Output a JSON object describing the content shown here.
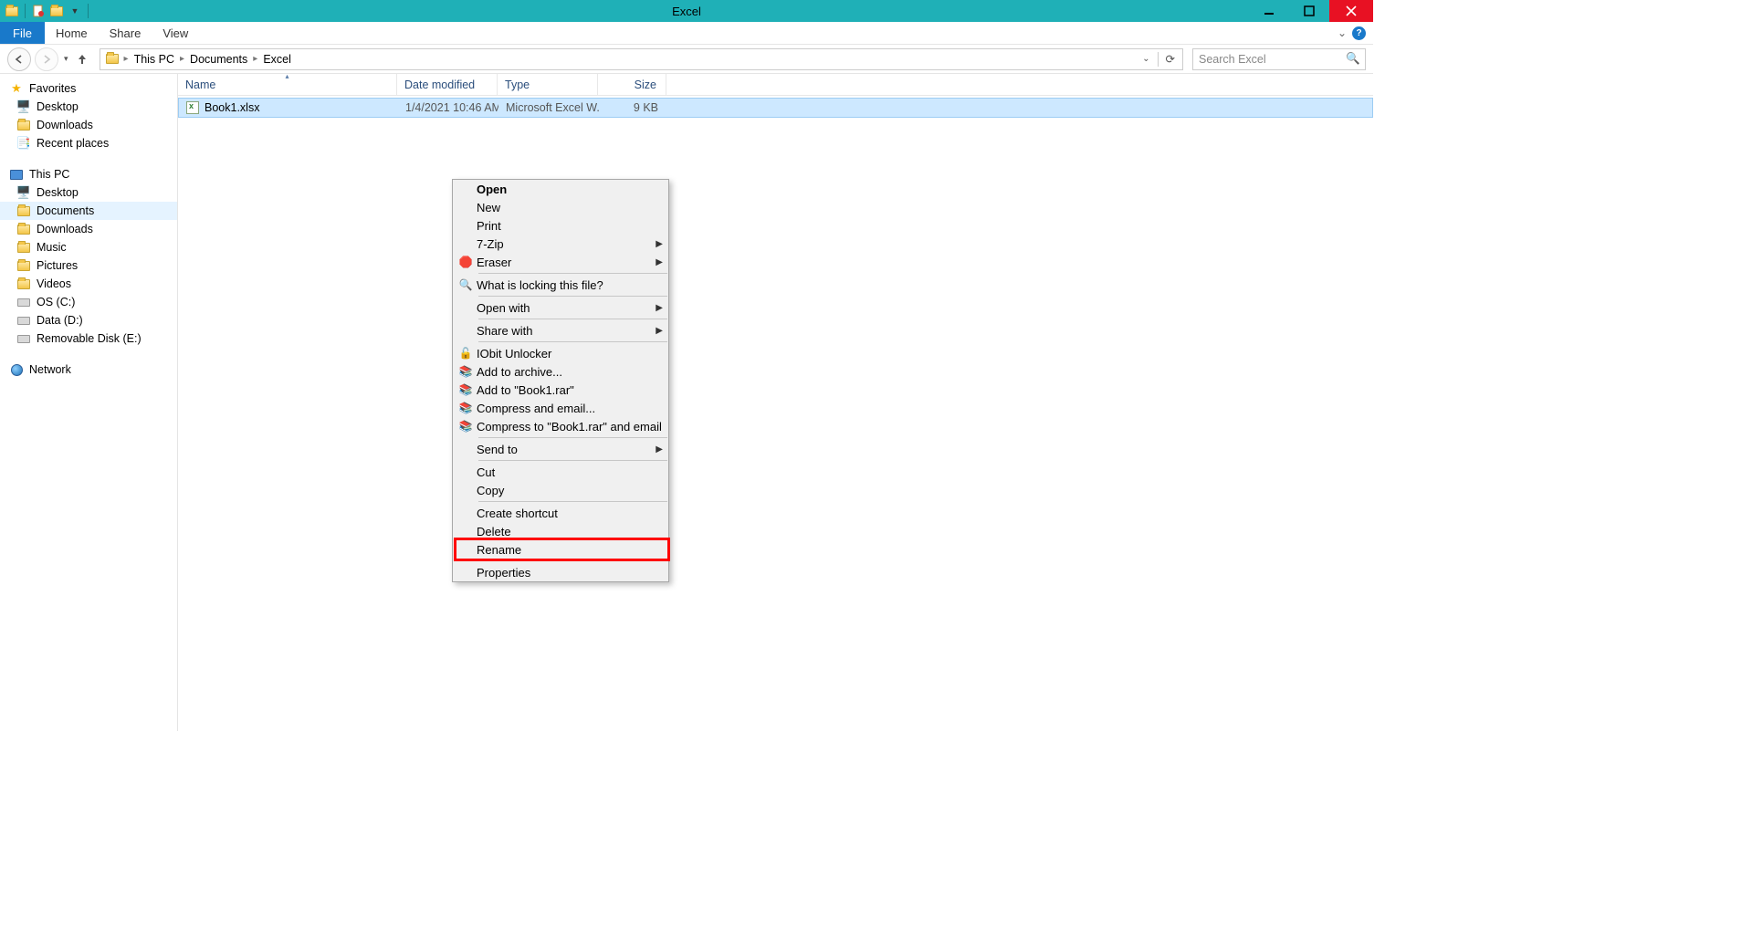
{
  "titlebar": {
    "title": "Excel"
  },
  "ribbon": {
    "file": "File",
    "tabs": [
      "Home",
      "Share",
      "View"
    ]
  },
  "breadcrumbs": [
    "This PC",
    "Documents",
    "Excel"
  ],
  "search": {
    "placeholder": "Search Excel"
  },
  "nav": {
    "favorites": {
      "label": "Favorites",
      "items": [
        "Desktop",
        "Downloads",
        "Recent places"
      ]
    },
    "thispc": {
      "label": "This PC",
      "items": [
        "Desktop",
        "Documents",
        "Downloads",
        "Music",
        "Pictures",
        "Videos",
        "OS (C:)",
        "Data (D:)",
        "Removable Disk (E:)"
      ],
      "selected_index": 1
    },
    "network": {
      "label": "Network"
    }
  },
  "columns": {
    "name": "Name",
    "date": "Date modified",
    "type": "Type",
    "size": "Size"
  },
  "files": [
    {
      "name": "Book1.xlsx",
      "date": "1/4/2021 10:46 AM",
      "type": "Microsoft Excel W...",
      "size": "9 KB"
    }
  ],
  "context_menu": [
    {
      "label": "Open",
      "bold": true
    },
    {
      "label": "New"
    },
    {
      "label": "Print"
    },
    {
      "label": "7-Zip",
      "submenu": true
    },
    {
      "label": "Eraser",
      "submenu": true,
      "icon": "eraser"
    },
    {
      "sep": true
    },
    {
      "label": "What is locking this file?",
      "icon": "lock"
    },
    {
      "sep": true
    },
    {
      "label": "Open with",
      "submenu": true
    },
    {
      "sep": true
    },
    {
      "label": "Share with",
      "submenu": true
    },
    {
      "sep": true
    },
    {
      "label": "IObit Unlocker",
      "icon": "unlock"
    },
    {
      "label": "Add to archive...",
      "icon": "archive"
    },
    {
      "label": "Add to \"Book1.rar\"",
      "icon": "archive"
    },
    {
      "label": "Compress and email...",
      "icon": "archive"
    },
    {
      "label": "Compress to \"Book1.rar\" and email",
      "icon": "archive"
    },
    {
      "sep": true
    },
    {
      "label": "Send to",
      "submenu": true
    },
    {
      "sep": true
    },
    {
      "label": "Cut"
    },
    {
      "label": "Copy"
    },
    {
      "sep": true
    },
    {
      "label": "Create shortcut"
    },
    {
      "label": "Delete"
    },
    {
      "label": "Rename",
      "highlight": true
    },
    {
      "sep": true
    },
    {
      "label": "Properties"
    }
  ]
}
